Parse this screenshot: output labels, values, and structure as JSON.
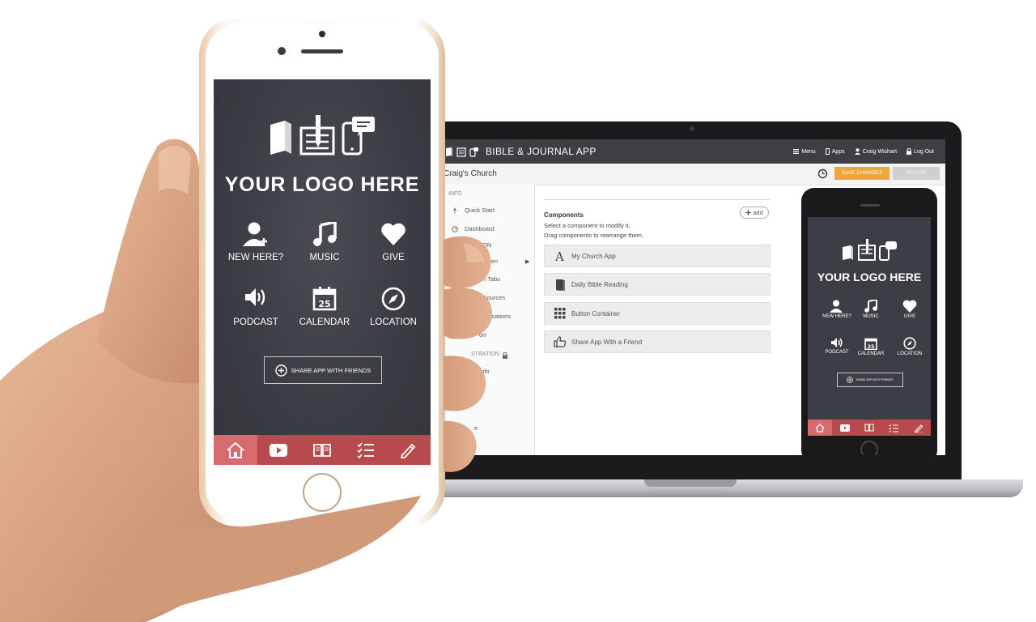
{
  "colors": {
    "screen_bg": "#3c3e45",
    "tab_bar": "#b84a4d",
    "tab_active": "#d66a6d",
    "save_button": "#f0a53b",
    "go_live_button": "#cfcfcf",
    "topbar": "#3e3f43"
  },
  "app": {
    "logo_text": "YOUR LOGO HERE",
    "tiles": [
      {
        "label": "NEW HERE?",
        "icon": "new-user-icon"
      },
      {
        "label": "MUSIC",
        "icon": "music-note-icon"
      },
      {
        "label": "GIVE",
        "icon": "heart-icon"
      },
      {
        "label": "PODCAST",
        "icon": "speaker-icon"
      },
      {
        "label": "CALENDAR",
        "icon": "calendar-icon",
        "day": "25"
      },
      {
        "label": "LOCATION",
        "icon": "compass-icon"
      }
    ],
    "share_label": "SHARE APP WITH FRIENDS",
    "tabs": [
      {
        "icon": "home-icon",
        "active": true
      },
      {
        "icon": "video-play-icon",
        "active": false
      },
      {
        "icon": "book-icon",
        "active": false
      },
      {
        "icon": "checklist-icon",
        "active": false
      },
      {
        "icon": "pencil-icon",
        "active": false
      }
    ]
  },
  "builder": {
    "title": "BIBLE & JOURNAL APP",
    "nav": [
      {
        "label": "Menu",
        "icon": "menu-icon"
      },
      {
        "label": "Apps",
        "icon": "phone-icon"
      },
      {
        "label": "Craig Wishart",
        "icon": "user-icon"
      },
      {
        "label": "Log Out",
        "icon": "lock-icon"
      }
    ],
    "church": "Craig's Church",
    "save_label": "SAVE CHANGES",
    "golive_label": "GO LIVE",
    "sidebar": [
      {
        "label": "INFO",
        "heading": true
      },
      {
        "label": "Quick Start",
        "icon": "rocket-icon"
      },
      {
        "label": "Dashboard",
        "icon": "dashboard-icon"
      },
      {
        "label": "ON"
      },
      {
        "label": "reen",
        "arrow": true
      },
      {
        "label": "ation Tabs"
      },
      {
        "label": "Media Sources"
      },
      {
        "label": "h Notifications"
      },
      {
        "label": "ort"
      },
      {
        "label": "STRATION",
        "heading": true,
        "lock": true
      },
      {
        "label": "Info"
      },
      {
        "label": "e"
      }
    ],
    "components": {
      "title": "Components",
      "sub1": "Select a component to modify it.",
      "sub2": "Drag components to rearrange them.",
      "add_label": "add",
      "items": [
        {
          "label": "My Church App",
          "icon": "text-a-icon"
        },
        {
          "label": "Daily Bible Reading",
          "icon": "book-icon"
        },
        {
          "label": "Button Container",
          "icon": "grid-icon"
        },
        {
          "label": "Share App With a Friend",
          "icon": "thumbs-up-icon"
        }
      ]
    }
  }
}
